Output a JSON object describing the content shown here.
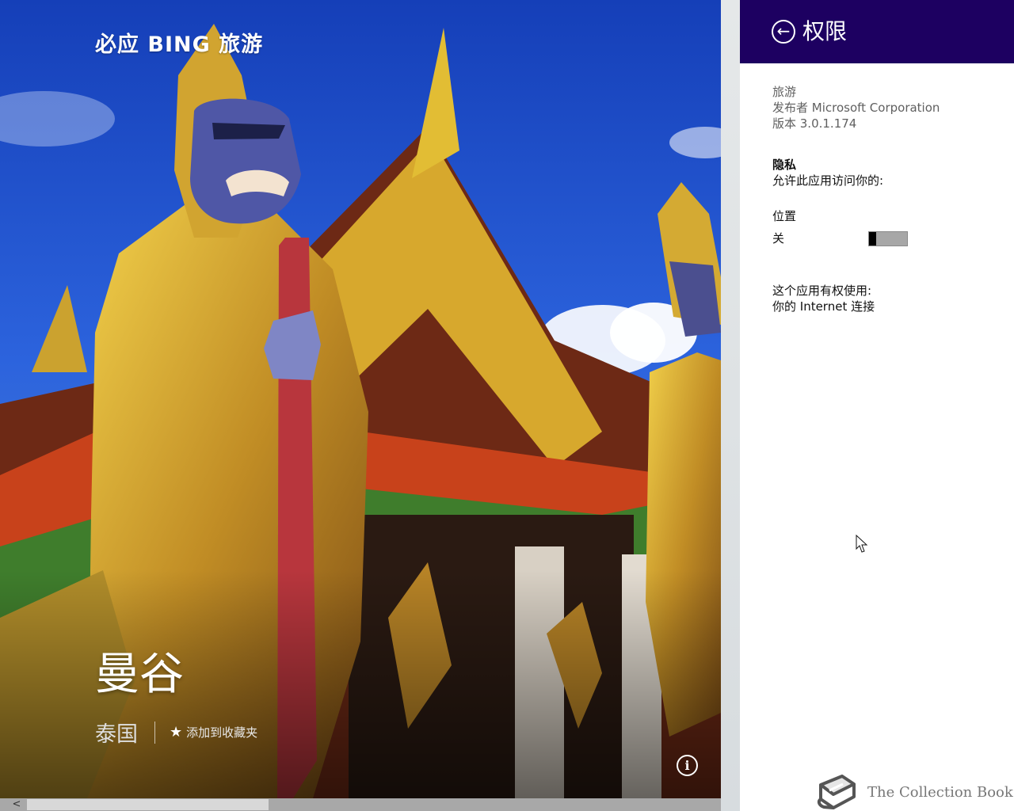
{
  "app": {
    "brand": "必应 BING 旅游",
    "city": "曼谷",
    "country": "泰国",
    "favorite_label": "添加到收藏夹",
    "info_label": "i"
  },
  "scrollbar": {
    "left_arrow": "<"
  },
  "permissions_flyout": {
    "title": "权限",
    "app_name": "旅游",
    "publisher": "发布者 Microsoft Corporation",
    "version": "版本 3.0.1.174",
    "privacy": {
      "title": "隐私",
      "description": "允许此应用访问你的:"
    },
    "location": {
      "label": "位置",
      "state": "关",
      "enabled": false
    },
    "capabilities": {
      "title": "这个应用有权使用:",
      "items": [
        "你的 Internet 连接"
      ]
    }
  },
  "watermark": {
    "text": "The Collection Book",
    "icon": "book-icon"
  },
  "icons": {
    "back": "arrow-left-circle-icon",
    "favorite": "star-icon",
    "info": "info-icon",
    "cursor": "mouse-pointer-icon"
  },
  "colors": {
    "flyout_header": "#1d0061",
    "toggle_off": "#a7a7a7"
  }
}
